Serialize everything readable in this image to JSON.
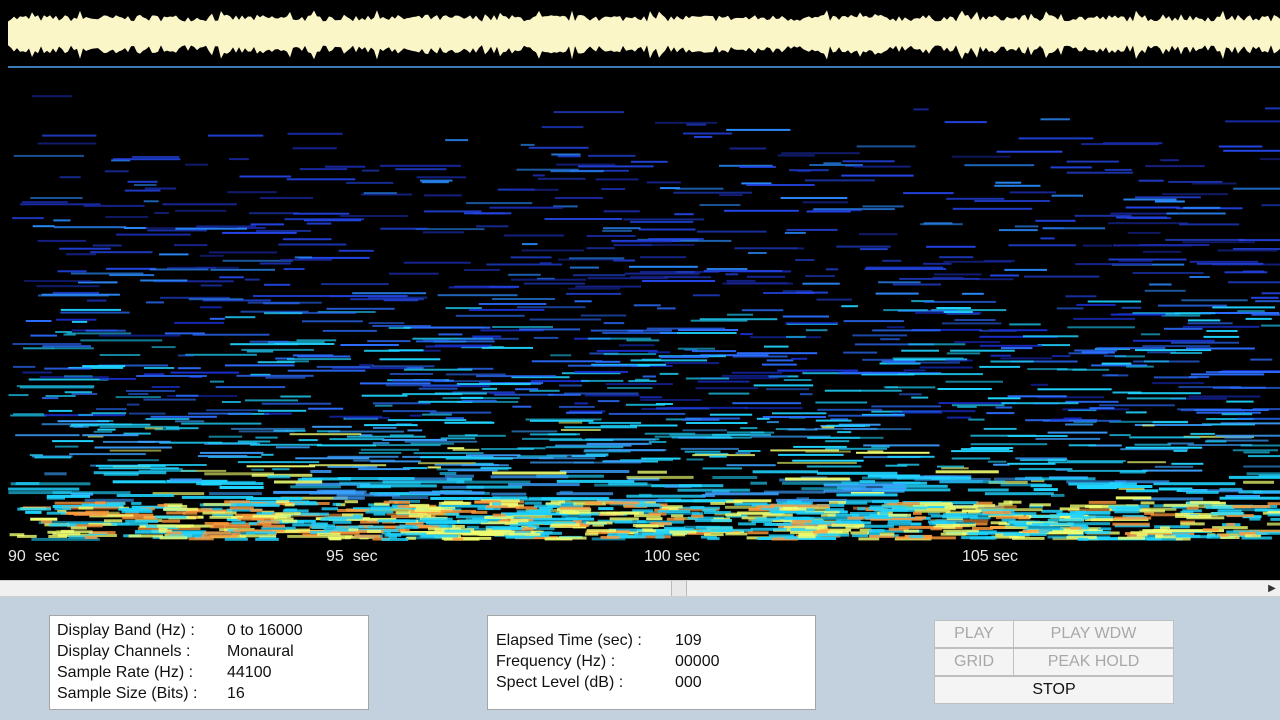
{
  "timeline": {
    "ticks": [
      {
        "label": "90  sec",
        "seconds": 90
      },
      {
        "label": "95  sec",
        "seconds": 95
      },
      {
        "label": "100 sec",
        "seconds": 100
      },
      {
        "label": "105 sec",
        "seconds": 105
      }
    ]
  },
  "info_panel": {
    "display_band_label": "Display Band (Hz) :",
    "display_band_value": "0 to 16000",
    "display_channels_label": "Display Channels :",
    "display_channels_value": "Monaural",
    "sample_rate_label": "Sample Rate (Hz) :",
    "sample_rate_value": "44100",
    "sample_size_label": "Sample Size (Bits) :",
    "sample_size_value": "16"
  },
  "readout_panel": {
    "elapsed_label": "Elapsed Time (sec) :",
    "elapsed_value": "109",
    "frequency_label": "Frequency (Hz) :",
    "frequency_value": "00000",
    "level_label": "Spect Level (dB) :",
    "level_value": "000"
  },
  "controls": {
    "play": "PLAY",
    "play_wdw": "PLAY WDW",
    "grid": "GRID",
    "peak_hold": "PEAK HOLD",
    "stop": "STOP"
  },
  "colors": {
    "waveform": "#fbf6c8",
    "background": "#000000",
    "panel_bg": "#c3d0dd",
    "spectral_low": "#1a2fd0",
    "spectral_mid": "#1fd4ff",
    "spectral_high": "#f0ff70"
  }
}
